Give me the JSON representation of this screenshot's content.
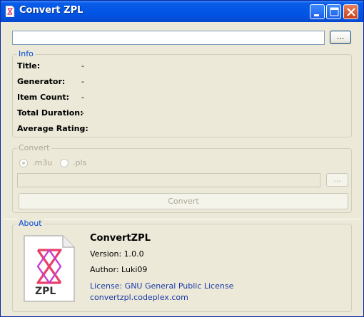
{
  "window": {
    "title": "Convert ZPL"
  },
  "file": {
    "path_value": "",
    "browse_label": "..."
  },
  "info": {
    "legend": "Info",
    "rows": [
      {
        "label": "Title:",
        "value": "-"
      },
      {
        "label": "Generator:",
        "value": "-"
      },
      {
        "label": "Item Count:",
        "value": "-"
      },
      {
        "label": "Total Duration:",
        "value": "-"
      },
      {
        "label": "Average Rating:",
        "value": "-"
      }
    ]
  },
  "convert": {
    "legend": "Convert",
    "options": [
      {
        "label": ".m3u",
        "selected": true
      },
      {
        "label": ".pls",
        "selected": false
      }
    ],
    "output_value": "",
    "browse_label": "...",
    "button_label": "Convert"
  },
  "about": {
    "legend": "About",
    "app_name": "ConvertZPL",
    "version": "Version: 1.0.0",
    "author": "Author: Luki09",
    "license": "License: GNU General Public License",
    "url": "convertzpl.codeplex.com",
    "logo_text": "ZPL"
  },
  "colors": {
    "titlebar": "#0055e5",
    "group_legend": "#0046d5",
    "window_bg": "#ece9d8",
    "zune_logo": "#e8406a"
  },
  "icons": [
    "app-icon",
    "minimize-icon",
    "maximize-icon",
    "close-icon",
    "zpl-file-icon"
  ]
}
